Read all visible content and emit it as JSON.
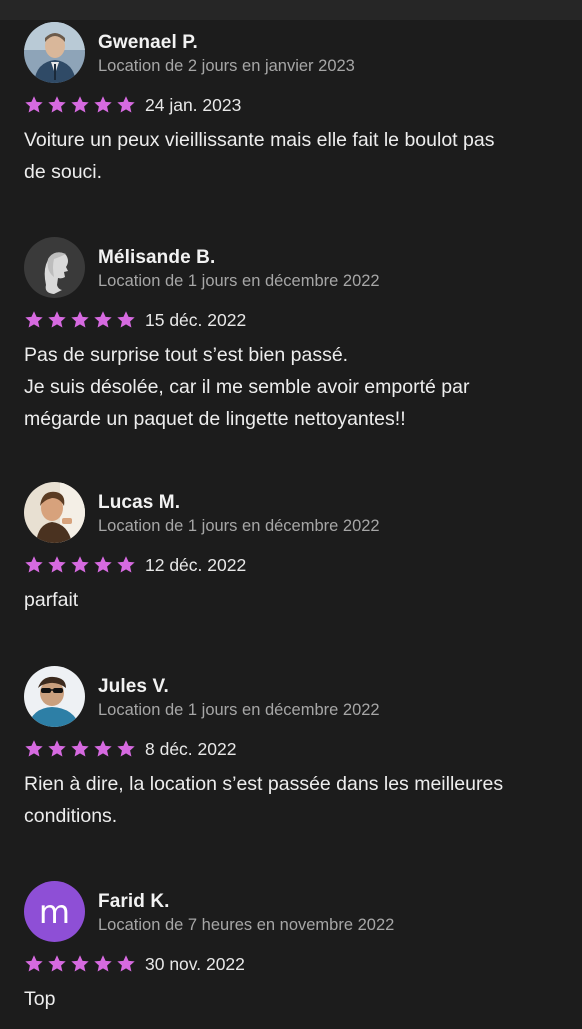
{
  "reviews": [
    {
      "name": "Gwenael P.",
      "meta": "Location de 2 jours en janvier 2023",
      "date": "24 jan. 2023",
      "rating": 5,
      "text": "Voiture un peux vieillissante mais elle fait le boulot pas\nde souci.",
      "avatar": "photo"
    },
    {
      "name": "Mélisande B.",
      "meta": "Location de 1 jours en décembre 2022",
      "date": "15 déc. 2022",
      "rating": 5,
      "text": "Pas de surprise tout s’est bien passé.\nJe suis désolée, car il me semble avoir emporté par\nmégarde un paquet de lingette nettoyantes!!",
      "avatar": "silhouette"
    },
    {
      "name": "Lucas M.",
      "meta": "Location de 1 jours en décembre 2022",
      "date": "12 déc. 2022",
      "rating": 5,
      "text": "parfait",
      "avatar": "photo"
    },
    {
      "name": "Jules V.",
      "meta": "Location de 1 jours en décembre 2022",
      "date": "8 déc. 2022",
      "rating": 5,
      "text": "Rien à dire, la location s’est passée dans les meilleures\nconditions.",
      "avatar": "photo"
    },
    {
      "name": "Farid K.",
      "meta": "Location de 7 heures en novembre 2022",
      "date": "30 nov. 2022",
      "rating": 5,
      "text": "Top",
      "avatar": "letter",
      "avatar_letter": "m"
    }
  ],
  "colors": {
    "background": "#1c1c1c",
    "star": "#d66ae0",
    "meta": "#a6a6a6",
    "letter_avatar": "#8e4fd6"
  },
  "icons": {
    "star": "star-icon"
  }
}
